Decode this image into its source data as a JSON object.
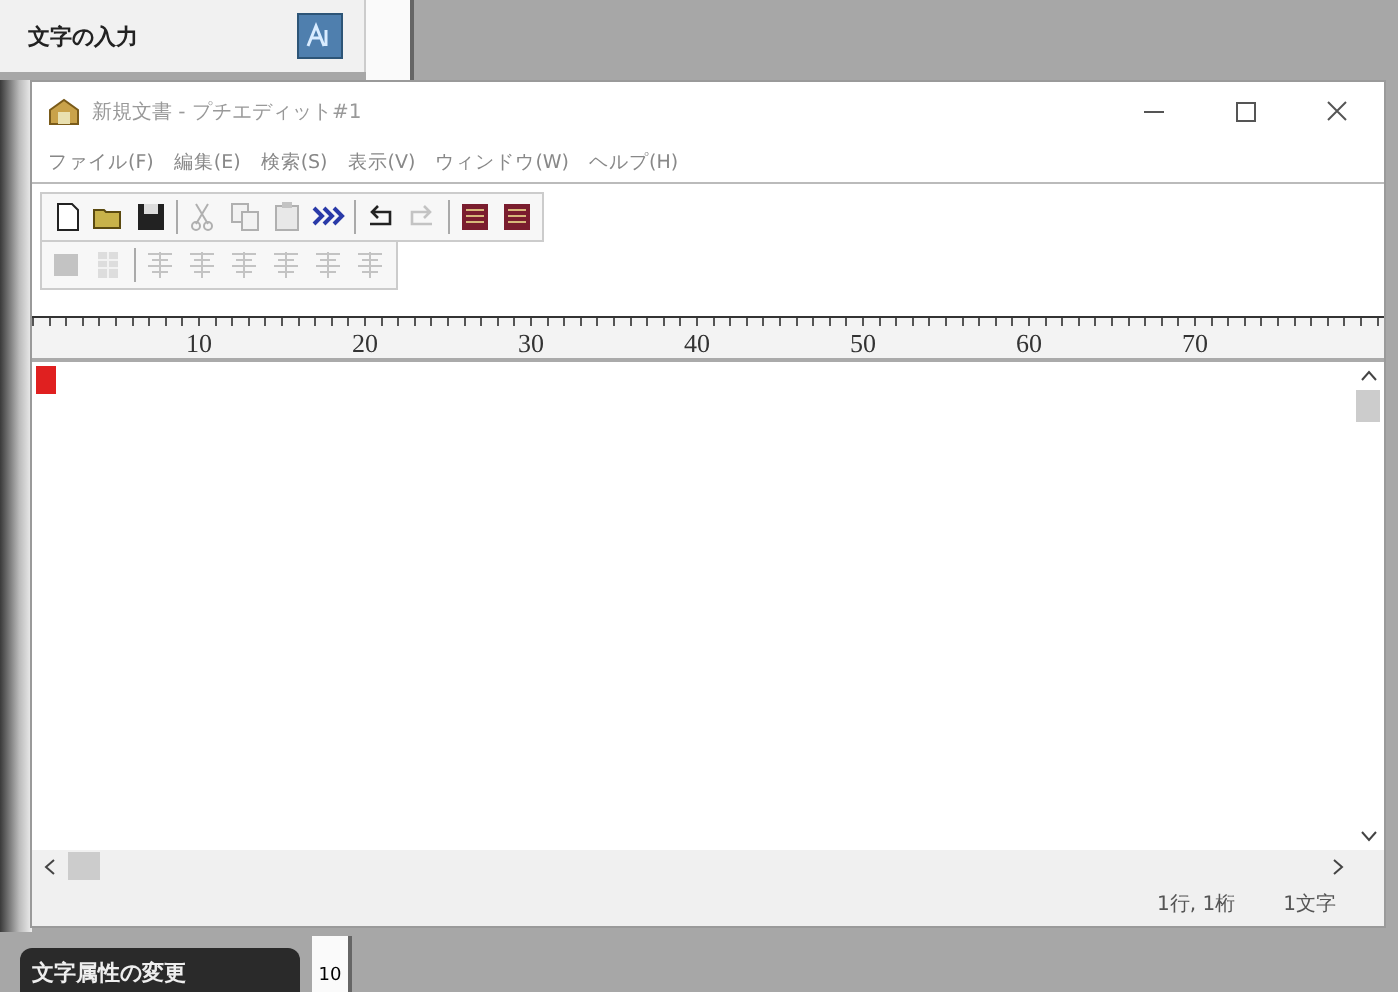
{
  "background_app": {
    "top_heading": "文字の入力",
    "bottom_heading": "文字属性の変更",
    "bottom_ruler_number": "10"
  },
  "window": {
    "title": "新規文書 - プチエディット#1"
  },
  "menu": [
    "ファイル(F)",
    "編集(E)",
    "検索(S)",
    "表示(V)",
    "ウィンドウ(W)",
    "ヘルプ(H)"
  ],
  "toolbar_1": [
    {
      "kind": "new",
      "disabled": false
    },
    {
      "kind": "open",
      "disabled": false
    },
    {
      "kind": "save",
      "disabled": false
    },
    {
      "kind": "sep"
    },
    {
      "kind": "cut",
      "disabled": true
    },
    {
      "kind": "copy",
      "disabled": true
    },
    {
      "kind": "paste",
      "disabled": true
    },
    {
      "kind": "chevrons",
      "disabled": false
    },
    {
      "kind": "sep"
    },
    {
      "kind": "undo",
      "disabled": false
    },
    {
      "kind": "redo",
      "disabled": true
    },
    {
      "kind": "sep"
    },
    {
      "kind": "book",
      "disabled": false
    },
    {
      "kind": "book",
      "disabled": false
    }
  ],
  "toolbar_2": [
    {
      "kind": "square",
      "disabled": true
    },
    {
      "kind": "grid",
      "disabled": true
    },
    {
      "kind": "sep"
    },
    {
      "kind": "align",
      "disabled": true
    },
    {
      "kind": "align",
      "disabled": true
    },
    {
      "kind": "align",
      "disabled": true
    },
    {
      "kind": "align",
      "disabled": true
    },
    {
      "kind": "align",
      "disabled": true
    },
    {
      "kind": "align",
      "disabled": true
    }
  ],
  "ruler": [
    "10",
    "20",
    "30",
    "40",
    "50",
    "60",
    "70"
  ],
  "status_bar": {
    "position": "1行, 1桁",
    "count": "1文字"
  }
}
